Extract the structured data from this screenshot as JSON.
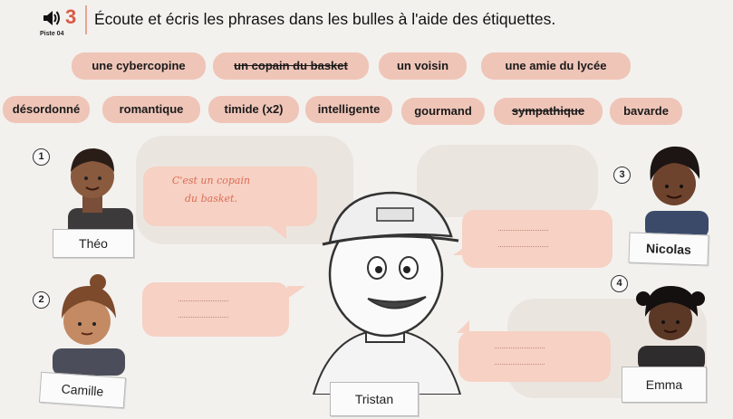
{
  "exercise": {
    "number": "3",
    "track": "Piste 04",
    "instruction": "Écoute et écris les phrases dans les bulles à l'aide des étiquettes."
  },
  "tags_row1": [
    {
      "label": "une cybercopine",
      "crossed": false
    },
    {
      "label": "un copain du basket",
      "crossed": true
    },
    {
      "label": "un voisin",
      "crossed": false
    },
    {
      "label": "une amie du lycée",
      "crossed": false
    }
  ],
  "tags_row2": [
    {
      "label": "désordonné",
      "crossed": false
    },
    {
      "label": "romantique",
      "crossed": false
    },
    {
      "label": "timide (x2)",
      "crossed": false
    },
    {
      "label": "intelligente",
      "crossed": false
    },
    {
      "label": "gourmand",
      "crossed": false
    },
    {
      "label": "sympathique",
      "crossed": true
    },
    {
      "label": "bavarde",
      "crossed": false
    }
  ],
  "example_bubble": {
    "line1": "C'est un copain",
    "line2": "du basket."
  },
  "characters": [
    {
      "number": "1",
      "name": "Théo"
    },
    {
      "number": "2",
      "name": "Camille"
    },
    {
      "number": "3",
      "name": "Nicolas"
    },
    {
      "number": "4",
      "name": "Emma"
    },
    {
      "number": "",
      "name": "Tristan"
    }
  ],
  "colors": {
    "accent": "#d85b45",
    "tag_bg": "#efc5b8",
    "bubble_bg": "#f6d1c4",
    "handwriting": "#dc6d55"
  }
}
